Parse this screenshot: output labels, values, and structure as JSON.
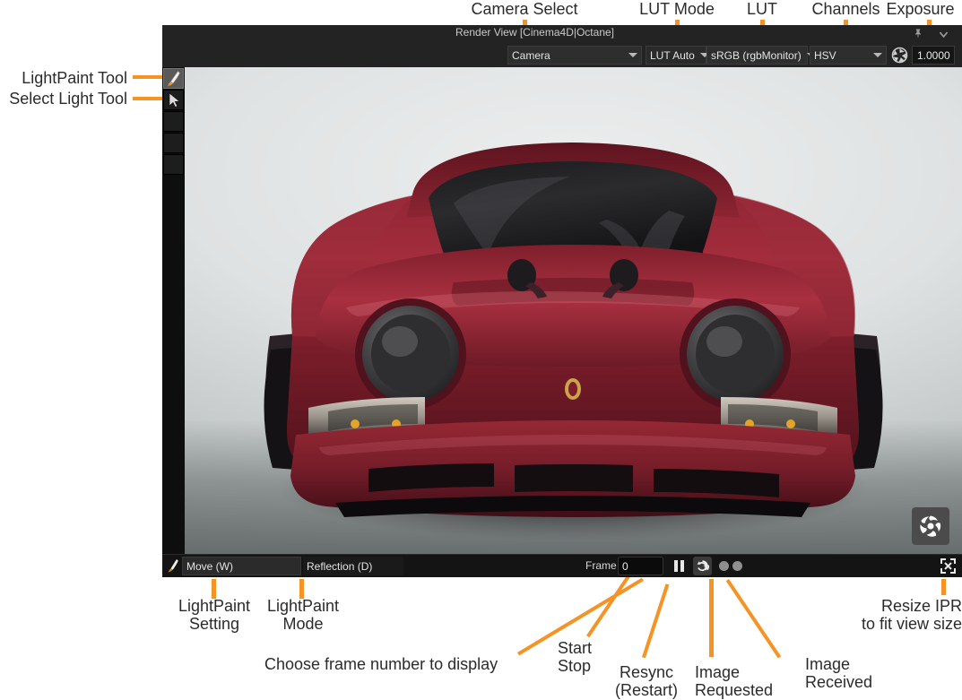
{
  "window": {
    "title": "Render View [Cinema4D|Octane]",
    "pin_icon": "pin-icon",
    "collapse_icon": "chevron-down-icon",
    "accent_color": "#f59325",
    "panel_bg": "#1b1b1b"
  },
  "top_toolbar": {
    "camera_select": {
      "value": "Camera",
      "caret_icon": "chevron-down-icon"
    },
    "lut_mode": {
      "value": "LUT Auto",
      "caret_icon": "chevron-down-icon"
    },
    "lut": {
      "value": "sRGB (rgbMonitor)",
      "caret_icon": "chevron-down-icon"
    },
    "channels": {
      "value": "HSV",
      "caret_icon": "chevron-down-icon"
    },
    "exposure": {
      "icon": "aperture-icon",
      "value": "1.0000"
    }
  },
  "sidebar": {
    "tools": [
      {
        "name": "lightpaint-tool",
        "icon": "paintbrush-icon",
        "selected": true
      },
      {
        "name": "select-light-tool",
        "icon": "cursor-arrow-icon",
        "selected": false
      },
      {
        "name": "tool-slot-3",
        "icon": "",
        "selected": false
      },
      {
        "name": "tool-slot-4",
        "icon": "",
        "selected": false
      },
      {
        "name": "tool-slot-5",
        "icon": "",
        "selected": false
      }
    ]
  },
  "render_view": {
    "subject": "dark red Porsche 911 front view on light grey studio backdrop",
    "watermark_icon": "octane-render-logo-icon"
  },
  "bottom_toolbar": {
    "lightpaint_icon": "paintbrush-icon",
    "lightpaint_setting": {
      "value": "Move (W)",
      "caret_icon": "chevron-down-icon"
    },
    "lightpaint_mode": {
      "value": "Reflection (D)",
      "caret_icon": "chevron-down-icon"
    },
    "frame_label": "Frame",
    "frame_value": "0",
    "start_stop": {
      "icon": "pause-icon"
    },
    "resync": {
      "icon": "resync-circular-arrows-icon"
    },
    "image_requested": {
      "icon": "status-dot-icon"
    },
    "image_received": {
      "icon": "status-dot-icon"
    },
    "resize_ipr": {
      "icon": "fit-to-view-arrows-icon"
    }
  },
  "annotations": {
    "camera_select": "Camera Select",
    "lut_mode": "LUT Mode",
    "lut": "LUT",
    "channels": "Channels",
    "exposure": "Exposure",
    "lightpaint_tool": "LightPaint Tool",
    "select_light_tool": "Select Light Tool",
    "lightpaint_setting": "LightPaint\nSetting",
    "lightpaint_mode": "LightPaint\nMode",
    "choose_frame": "Choose frame number to display",
    "start_stop": "Start\nStop",
    "resync": "Resync\n(Restart)",
    "image_requested": "Image\nRequested",
    "image_received": "Image\nReceived",
    "resize_ipr": "Resize IPR\nto fit view size"
  }
}
